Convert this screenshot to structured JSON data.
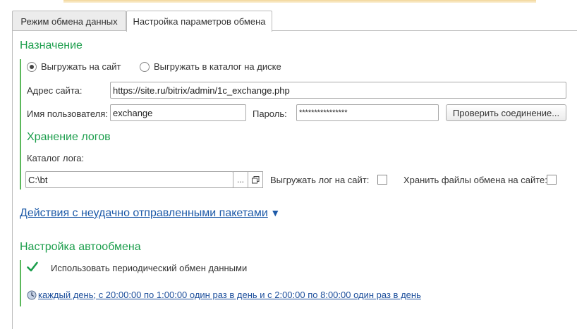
{
  "tabs": [
    {
      "label": "Режим обмена данных",
      "active": false
    },
    {
      "label": "Настройка параметров обмена",
      "active": true
    }
  ],
  "destination": {
    "title": "Назначение",
    "radio_site": "Выгружать на сайт",
    "radio_disk": "Выгружать в каталог на диске",
    "selected": "site",
    "site_address_label": "Адрес сайта:",
    "site_address_value": "https://site.ru/bitrix/admin/1c_exchange.php",
    "username_label": "Имя пользователя:",
    "username_value": "exchange",
    "password_label": "Пароль:",
    "password_value": "****************",
    "check_button": "Проверить соединение..."
  },
  "logs": {
    "title": "Хранение логов",
    "catalog_label": "Каталог лога:",
    "catalog_value": "C:\\bt",
    "browse_button": "...",
    "open_button_icon": "copy-window-icon",
    "upload_log_label": "Выгружать лог на сайт:",
    "upload_log_checked": false,
    "store_files_label": "Хранить файлы обмена на сайте:",
    "store_files_checked": false
  },
  "failed_packets": {
    "link": "Действия с неудачно отправленными пакетами",
    "arrow": "▼"
  },
  "auto_exchange": {
    "title": "Настройка автообмена",
    "use_periodic_label": "Использовать периодический обмен данными",
    "use_periodic_checked": true,
    "schedule_link": "каждый день; с 20:00:00 по 1:00:00 один раз в день и с 2:00:00 по 8:00:00 один раз в день",
    "schedule_icon": "clock-icon"
  },
  "colors": {
    "section_green": "#1c9e4c",
    "accent_bar": "#5cb85c",
    "link_blue": "#1d5aa8"
  }
}
